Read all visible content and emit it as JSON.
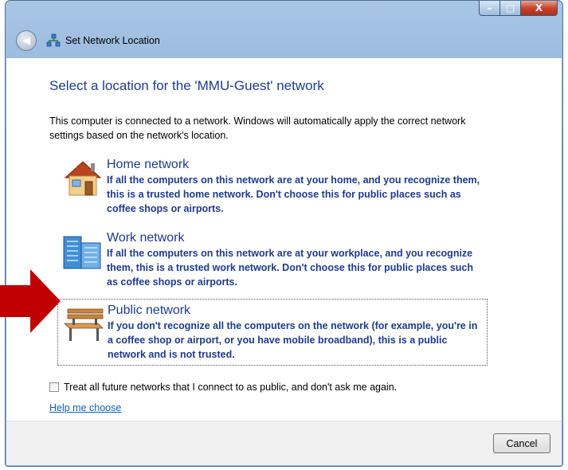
{
  "window": {
    "title": "Set Network Location",
    "caption": {
      "minimize": "–",
      "maximize": "□",
      "close": "X"
    }
  },
  "heading": "Select a location for the 'MMU-Guest' network",
  "intro": "This computer is connected to a network. Windows will automatically apply the correct network settings based on the network's location.",
  "options": [
    {
      "title": "Home network",
      "description": "If all the computers on this network are at your home, and you recognize them, this is a trusted home network.  Don't choose this for public places such as coffee shops or airports.",
      "icon": "house-icon"
    },
    {
      "title": "Work network",
      "description": "If all the computers on this network are at your workplace, and you recognize them, this is a trusted work network.  Don't choose this for public places such as coffee shops or airports.",
      "icon": "office-building-icon"
    },
    {
      "title": "Public network",
      "description": "If you don't recognize all the computers on the network (for example, you're in a coffee shop or airport, or you have mobile broadband), this is a public network and is not trusted.",
      "icon": "park-bench-icon"
    }
  ],
  "checkbox": {
    "label": "Treat all future networks that I connect to as public, and don't ask me again.",
    "checked": false
  },
  "help_link": "Help me choose",
  "cancel_label": "Cancel",
  "colors": {
    "heading": "#1e3a8c",
    "link": "#0b62c4",
    "arrow": "#c00000"
  }
}
